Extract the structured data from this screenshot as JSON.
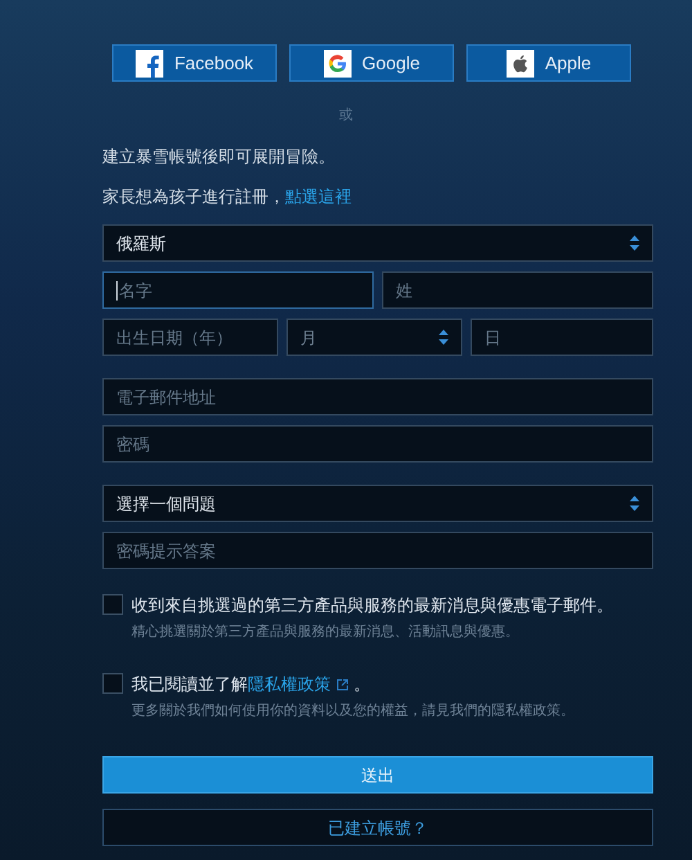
{
  "social_buttons": [
    {
      "kind": "facebook",
      "label": "Facebook"
    },
    {
      "kind": "google",
      "label": "Google"
    },
    {
      "kind": "apple",
      "label": "Apple"
    }
  ],
  "separator": "或",
  "intro": "建立暴雪帳號後即可展開冒險。",
  "parent_note": {
    "text": "家長想為孩子進行註冊，",
    "link": "點選這裡"
  },
  "field_groups": [
    [
      [
        {
          "kind": "select",
          "value": "俄羅斯"
        }
      ],
      [
        {
          "kind": "input",
          "placeholder": "名字",
          "focused": true
        },
        {
          "kind": "input",
          "placeholder": "姓",
          "focused": false
        }
      ],
      [
        {
          "kind": "input",
          "placeholder": "出生日期（年）",
          "focused": false
        },
        {
          "kind": "select",
          "placeholder": "月"
        },
        {
          "kind": "input",
          "placeholder": "日",
          "focused": false
        }
      ]
    ],
    [
      [
        {
          "kind": "input",
          "placeholder": "電子郵件地址",
          "focused": false
        }
      ],
      [
        {
          "kind": "input",
          "placeholder": "密碼",
          "focused": false
        }
      ]
    ],
    [
      [
        {
          "kind": "select",
          "value": "選擇一個問題"
        }
      ],
      [
        {
          "kind": "input",
          "placeholder": "密碼提示答案",
          "focused": false
        }
      ]
    ]
  ],
  "checkboxes": [
    {
      "kind": "plain",
      "label": "收到來自挑選過的第三方產品與服務的最新消息與優惠電子郵件。",
      "sublabel": "精心挑選關於第三方產品與服務的最新消息、活動訊息與優惠。",
      "checked": false
    },
    {
      "kind": "link",
      "label": "我已閱讀並了解",
      "link": "隱私權政策",
      "label_end": " 。",
      "sublabel": "更多關於我們如何使用你的資料以及您的權益，請見我們的隱私權政策。",
      "checked": false
    }
  ],
  "submit_button": "送出",
  "existing_account_button": "已建立帳號？"
}
